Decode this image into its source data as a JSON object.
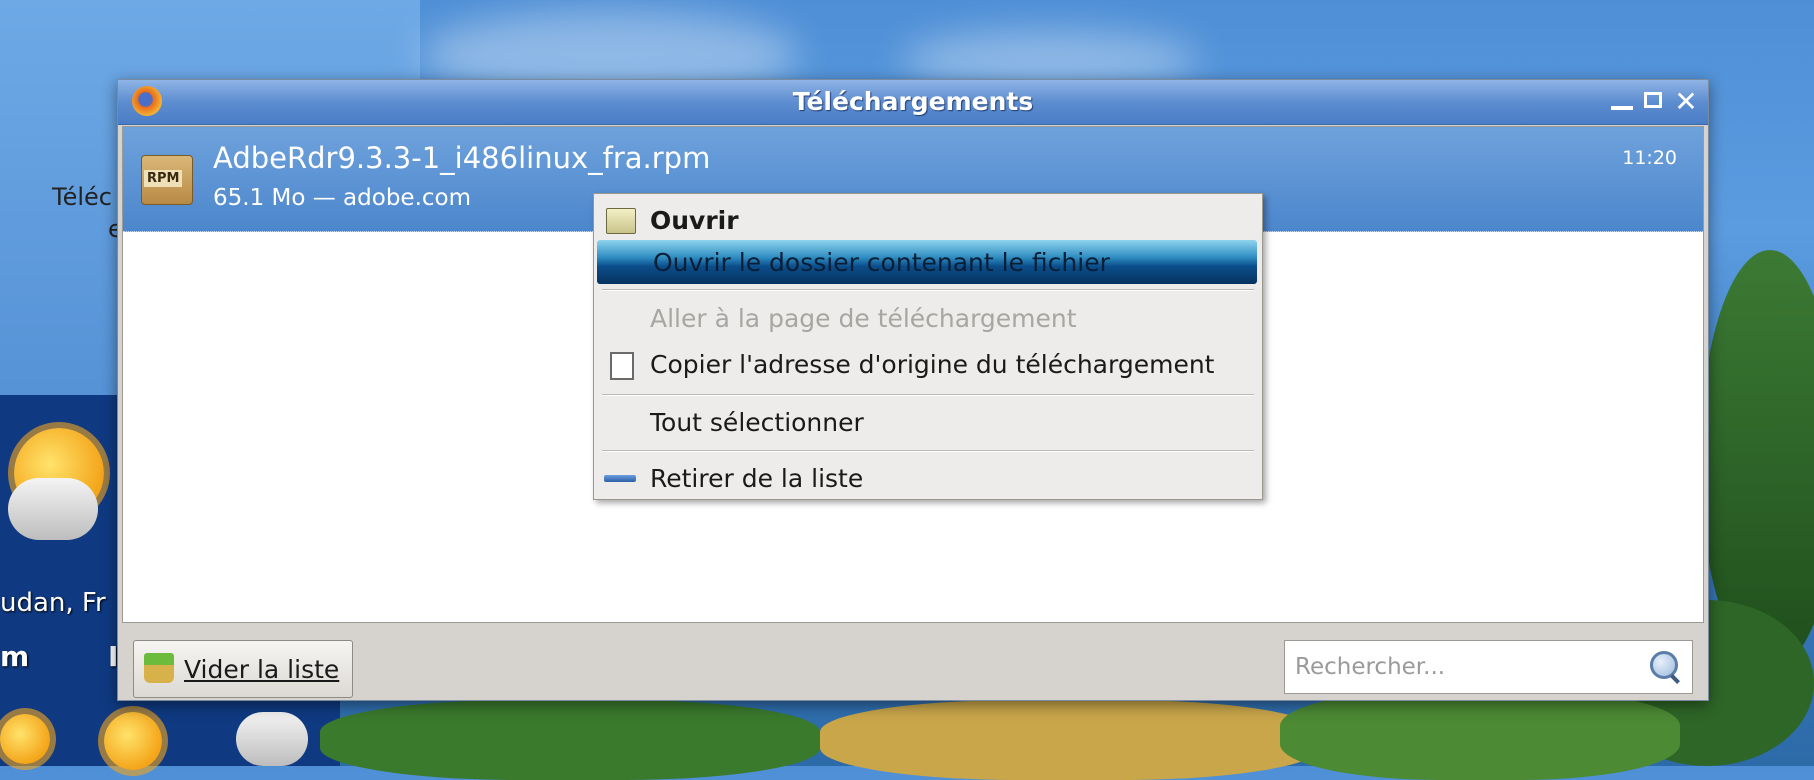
{
  "desktop": {
    "icon_label_line1": "Téléc",
    "icon_label_line2": "e",
    "weather_location": "udan, Fr",
    "weather_day_left": "m",
    "weather_day_right": "I"
  },
  "window": {
    "title": "Téléchargements",
    "controls": {
      "minimize": "",
      "maximize": "",
      "close": "✕"
    }
  },
  "download": {
    "file_icon_label": "RPM",
    "name": "AdbeRdr9.3.3-1_i486linux_fra.rpm",
    "meta": "65.1 Mo — adobe.com",
    "time": "11:20"
  },
  "context_menu": {
    "items": [
      {
        "label": "Ouvrir",
        "icon": "folder-icon"
      },
      {
        "label": "Ouvrir le dossier contenant le fichier",
        "icon": ""
      },
      {
        "label": "Aller à la page de téléchargement",
        "icon": ""
      },
      {
        "label": "Copier l'adresse d'origine du téléchargement",
        "icon": "copy-icon"
      },
      {
        "label": "Tout sélectionner",
        "icon": ""
      },
      {
        "label": "Retirer de la liste",
        "icon": "remove-icon"
      }
    ]
  },
  "bottom": {
    "clear_label": "Vider la liste",
    "search_placeholder": "Rechercher..."
  }
}
